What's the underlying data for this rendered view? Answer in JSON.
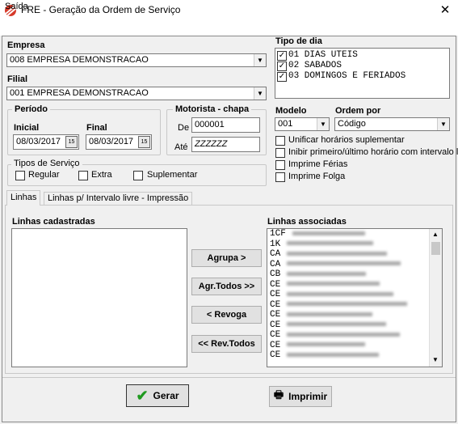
{
  "window": {
    "title": "FRE - Geração da Ordem de Serviço",
    "close_glyph": "✕"
  },
  "menu": {
    "items": [
      "Saída"
    ]
  },
  "empresa": {
    "label": "Empresa",
    "value": "008 EMPRESA DEMONSTRACAO"
  },
  "filial": {
    "label": "Filial",
    "value": "001 EMPRESA DEMONSTRACAO"
  },
  "tipo_dia": {
    "label": "Tipo de dia",
    "items": [
      {
        "label": "01 DIAS UTEIS",
        "checked": true
      },
      {
        "label": "02 SABADOS",
        "checked": true
      },
      {
        "label": "03 DOMINGOS E FERIADOS",
        "checked": true
      }
    ]
  },
  "periodo": {
    "label": "Período",
    "inicial_label": "Inicial",
    "inicial_value": "08/03/2017",
    "final_label": "Final",
    "final_value": "08/03/2017",
    "cal_glyph": "15"
  },
  "motorista": {
    "label": "Motorista - chapa",
    "de_label": "De",
    "de_value": "000001",
    "ate_label": "Até",
    "ate_value": "ZZZZZZ"
  },
  "modelo": {
    "label": "Modelo",
    "value": "001"
  },
  "ordem": {
    "label": "Ordem por",
    "value": "Código"
  },
  "opcoes": [
    {
      "label": "Unificar horários suplementar",
      "checked": false
    },
    {
      "label": "Inibir primeiro/último horário com intervalo livre",
      "checked": false
    },
    {
      "label": "Imprime Férias",
      "checked": false
    },
    {
      "label": "Imprime Folga",
      "checked": false
    }
  ],
  "tipos_servico": {
    "label": "Tipos de Serviço",
    "items": [
      {
        "label": "Regular",
        "checked": false
      },
      {
        "label": "Extra",
        "checked": false
      },
      {
        "label": "Suplementar",
        "checked": false
      }
    ]
  },
  "tabs": [
    {
      "label": "Linhas",
      "active": true
    },
    {
      "label": "Linhas p/ Intervalo livre - Impressão",
      "active": false
    }
  ],
  "linhas_cadastradas": {
    "label": "Linhas cadastradas"
  },
  "linhas_associadas": {
    "label": "Linhas associadas",
    "items": [
      "1CF",
      "1K",
      "CA",
      "CA",
      "CB",
      "CE",
      "CE",
      "CE",
      "CE",
      "CE",
      "CE",
      "CE",
      "CE"
    ]
  },
  "buttons": {
    "agrupa": "Agrupa >",
    "agr_todos": "Agr.Todos >>",
    "revoga": "< Revoga",
    "rev_todos": "<< Rev.Todos",
    "gerar": "Gerar",
    "imprimir": "Imprimir"
  },
  "colors": {
    "accent": "#d63a2a",
    "check_green": "#1f9a1f"
  }
}
